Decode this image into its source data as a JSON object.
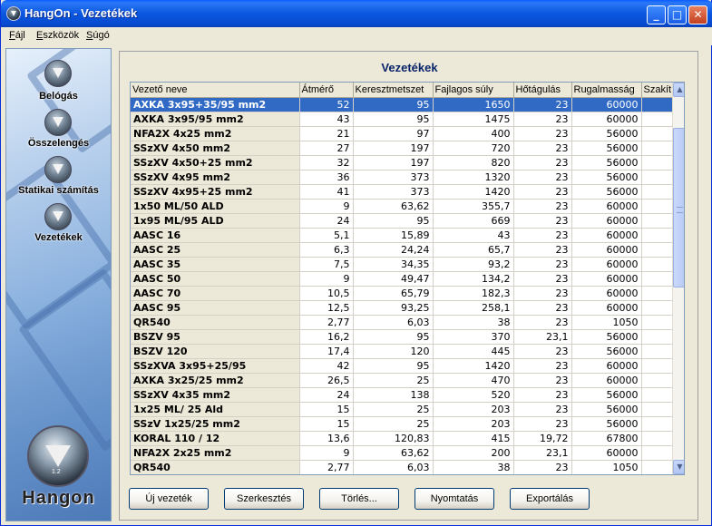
{
  "window": {
    "title": "HangOn - Vezetékek",
    "controls": {
      "minimize": "_",
      "maximize": "□",
      "close": "✕"
    }
  },
  "menu": {
    "items": [
      {
        "label": "Fájl",
        "accel": "F",
        "rest": "ájl"
      },
      {
        "label": "Eszközök",
        "accel": "E",
        "rest": "szközök"
      },
      {
        "label": "Súgó",
        "accel": "S",
        "rest": "úgó"
      }
    ]
  },
  "sidebar": {
    "items": [
      {
        "label": "Belógás",
        "icon": "hangon-logo-icon"
      },
      {
        "label": "Összelengés",
        "icon": "hangon-logo-icon"
      },
      {
        "label": "Statikai számítás",
        "icon": "hangon-logo-icon"
      },
      {
        "label": "Vezetékek",
        "icon": "hangon-logo-icon"
      }
    ],
    "logo_text": "Hangon",
    "logo_version": "1.2"
  },
  "panel": {
    "title": "Vezetékek"
  },
  "table": {
    "columns": [
      "Vezető neve",
      "Átmérő",
      "Keresztmetszet",
      "Fajlagos súly",
      "Hőtágulás",
      "Rugalmasság",
      "Szakít"
    ],
    "selected_row": 0,
    "rows": [
      [
        "AXKA 3x95+35/95 mm2",
        "52",
        "95",
        "1650",
        "23",
        "60000",
        ""
      ],
      [
        "AXKA 3x95/95 mm2",
        "43",
        "95",
        "1475",
        "23",
        "60000",
        ""
      ],
      [
        "NFA2X 4x25 mm2",
        "21",
        "97",
        "400",
        "23",
        "56000",
        ""
      ],
      [
        "SSzXV 4x50 mm2",
        "27",
        "197",
        "720",
        "23",
        "56000",
        ""
      ],
      [
        "SSzXV 4x50+25 mm2",
        "32",
        "197",
        "820",
        "23",
        "56000",
        ""
      ],
      [
        "SSzXV 4x95 mm2",
        "36",
        "373",
        "1320",
        "23",
        "56000",
        ""
      ],
      [
        "SSzXV 4x95+25 mm2",
        "41",
        "373",
        "1420",
        "23",
        "56000",
        ""
      ],
      [
        "1x50 ML/50 ALD",
        "9",
        "63,62",
        "355,7",
        "23",
        "60000",
        ""
      ],
      [
        "1x95 ML/95 ALD",
        "24",
        "95",
        "669",
        "23",
        "60000",
        ""
      ],
      [
        "AASC 16",
        "5,1",
        "15,89",
        "43",
        "23",
        "60000",
        ""
      ],
      [
        "AASC 25",
        "6,3",
        "24,24",
        "65,7",
        "23",
        "60000",
        ""
      ],
      [
        "AASC 35",
        "7,5",
        "34,35",
        "93,2",
        "23",
        "60000",
        ""
      ],
      [
        "AASC 50",
        "9",
        "49,47",
        "134,2",
        "23",
        "60000",
        ""
      ],
      [
        "AASC 70",
        "10,5",
        "65,79",
        "182,3",
        "23",
        "60000",
        ""
      ],
      [
        "AASC 95",
        "12,5",
        "93,25",
        "258,1",
        "23",
        "60000",
        ""
      ],
      [
        "QR540",
        "2,77",
        "6,03",
        "38",
        "23",
        "1050",
        ""
      ],
      [
        "BSZV 95",
        "16,2",
        "95",
        "370",
        "23,1",
        "56000",
        ""
      ],
      [
        "BSZV 120",
        "17,4",
        "120",
        "445",
        "23",
        "56000",
        ""
      ],
      [
        "SSzXVA 3x95+25/95",
        "42",
        "95",
        "1420",
        "23",
        "60000",
        ""
      ],
      [
        "AXKA 3x25/25 mm2",
        "26,5",
        "25",
        "470",
        "23",
        "60000",
        ""
      ],
      [
        "SSzXV 4x35 mm2",
        "24",
        "138",
        "520",
        "23",
        "56000",
        ""
      ],
      [
        "1x25 ML/ 25 Ald",
        "15",
        "25",
        "203",
        "23",
        "56000",
        ""
      ],
      [
        "SSzV 1x25/25 mm2",
        "15",
        "25",
        "203",
        "23",
        "56000",
        ""
      ],
      [
        "KORAL 110 / 12",
        "13,6",
        "120,83",
        "415",
        "19,72",
        "67800",
        ""
      ],
      [
        "NFA2X 2x25 mm2",
        "9",
        "63,62",
        "200",
        "23,1",
        "60000",
        ""
      ],
      [
        "QR540",
        "2,77",
        "6,03",
        "38",
        "23",
        "1050",
        ""
      ]
    ]
  },
  "buttons": {
    "new": "Új vezeték",
    "edit": "Szerkesztés",
    "delete": "Törlés...",
    "print": "Nyomtatás",
    "export": "Exportálás"
  }
}
